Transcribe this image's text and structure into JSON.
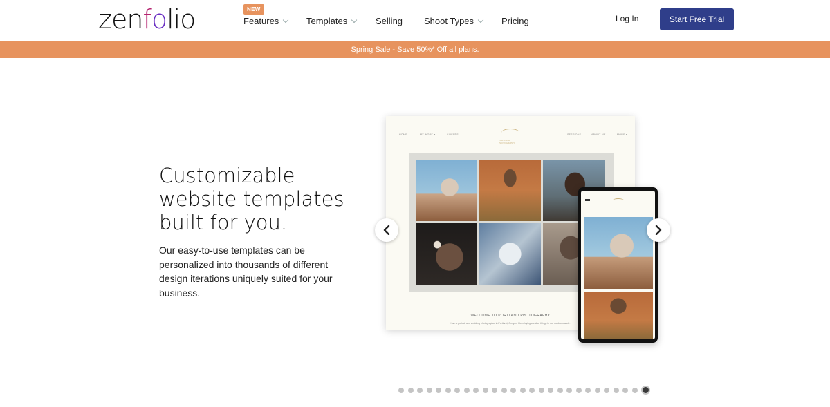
{
  "header": {
    "logo": {
      "parts": [
        "zen",
        "f",
        "o",
        "lio"
      ]
    },
    "nav": [
      {
        "label": "Features",
        "badge": "NEW",
        "has_dropdown": true
      },
      {
        "label": "Templates",
        "has_dropdown": true
      },
      {
        "label": "Selling",
        "has_dropdown": false
      },
      {
        "label": "Shoot Types",
        "has_dropdown": true
      },
      {
        "label": "Pricing",
        "has_dropdown": false
      }
    ],
    "login_label": "Log In",
    "cta_label": "Start Free Trial"
  },
  "banner": {
    "prefix": "Spring Sale -",
    "link": "Save 50%",
    "suffix": "* Off all plans."
  },
  "hero": {
    "title_lines": [
      "Customizable",
      "website templates",
      "built for you."
    ],
    "description": "Our easy-to-use templates can be personalized into thousands of different design iterations uniquely suited for your business."
  },
  "mockup": {
    "nav_left": [
      "HOME",
      "MY WORK ▾",
      "CLIENTS"
    ],
    "nav_right": [
      "SESSIONS",
      "ABOUT ME",
      "MORE ▾"
    ],
    "logo_sub": "PORTLAND PHOTOGRAPHY",
    "welcome": "WELCOME TO PORTLAND PHOTOGRAPHY",
    "caption": "I am a portrait and wedding photographer in Portland, Oregon. I love trying creative things in our outdoors and..."
  },
  "carousel": {
    "prev_icon": "chevron-left-icon",
    "next_icon": "chevron-right-icon",
    "total_slides": 27,
    "active_slide": 27
  },
  "colors": {
    "brand_orange": "#e7935e",
    "cta_blue": "#2f3e8a"
  }
}
